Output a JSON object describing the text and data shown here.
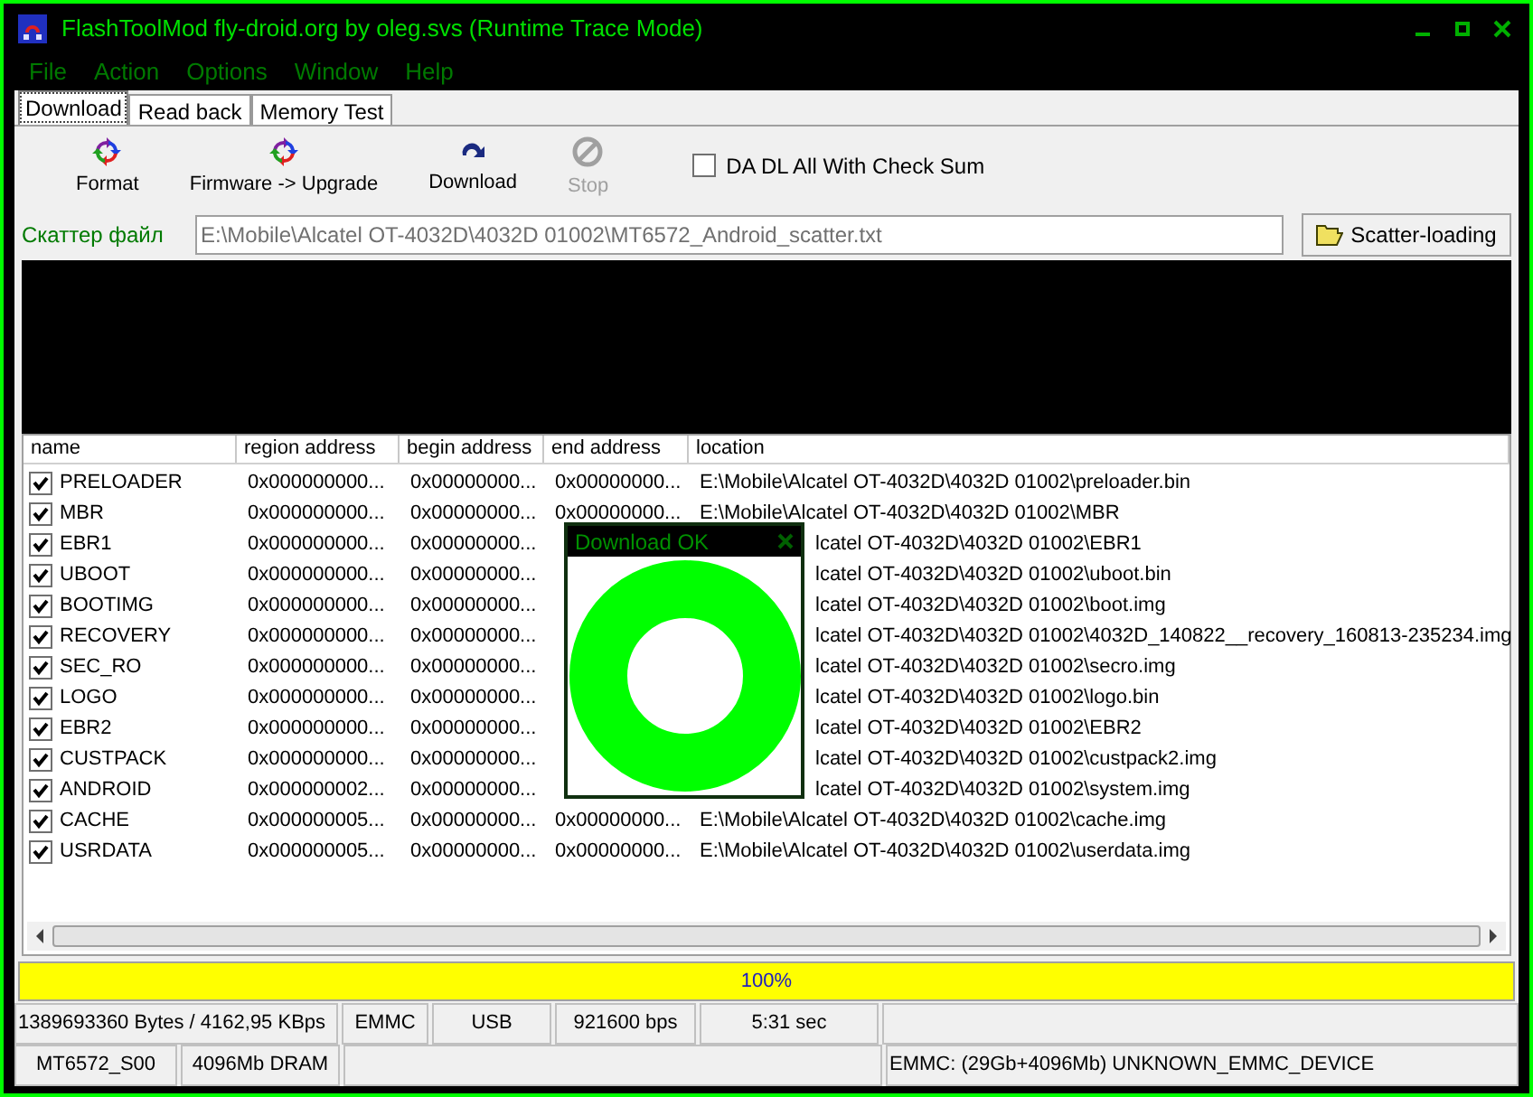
{
  "window": {
    "title": "FlashToolMod fly-droid.org by oleg.svs (Runtime Trace Mode)"
  },
  "menu": [
    "File",
    "Action",
    "Options",
    "Window",
    "Help"
  ],
  "tabs": [
    {
      "label": "Download",
      "selected": true
    },
    {
      "label": "Read back",
      "selected": false
    },
    {
      "label": "Memory Test",
      "selected": false
    }
  ],
  "toolbar": {
    "buttons": [
      {
        "kind": "cycle",
        "label": "Format",
        "disabled": false
      },
      {
        "kind": "cycle",
        "label": "Firmware -> Upgrade",
        "disabled": false
      },
      {
        "kind": "download",
        "label": "Download",
        "disabled": false
      },
      {
        "kind": "stop",
        "label": "Stop",
        "disabled": true
      }
    ],
    "checkbox": {
      "label": "DA DL All With Check Sum",
      "checked": false
    }
  },
  "scatter": {
    "label": "Скаттер файл",
    "value": "E:\\Mobile\\Alcatel OT-4032D\\4032D 01002\\MT6572_Android_scatter.txt",
    "button": "Scatter-loading"
  },
  "table": {
    "columns": [
      "name",
      "region address",
      "begin address",
      "end address",
      "location"
    ],
    "rows": [
      {
        "name": "PRELOADER",
        "checked": true,
        "region": "0x000000000...",
        "begin": "0x00000000...",
        "end": "0x00000000...",
        "location": "E:\\Mobile\\Alcatel OT-4032D\\4032D 01002\\preloader.bin",
        "covered": false
      },
      {
        "name": "MBR",
        "checked": true,
        "region": "0x000000000...",
        "begin": "0x00000000...",
        "end": "0x00000000...",
        "location": "E:\\Mobile\\Alcatel OT-4032D\\4032D 01002\\MBR",
        "covered": false
      },
      {
        "name": "EBR1",
        "checked": true,
        "region": "0x000000000...",
        "begin": "0x00000000...",
        "location": "lcatel OT-4032D\\4032D 01002\\EBR1",
        "covered": true
      },
      {
        "name": "UBOOT",
        "checked": true,
        "region": "0x000000000...",
        "begin": "0x00000000...",
        "location": "lcatel OT-4032D\\4032D 01002\\uboot.bin",
        "covered": true
      },
      {
        "name": "BOOTIMG",
        "checked": true,
        "region": "0x000000000...",
        "begin": "0x00000000...",
        "location": "lcatel OT-4032D\\4032D 01002\\boot.img",
        "covered": true
      },
      {
        "name": "RECOVERY",
        "checked": true,
        "region": "0x000000000...",
        "begin": "0x00000000...",
        "location": "lcatel OT-4032D\\4032D 01002\\4032D_140822__recovery_160813-235234.img",
        "covered": true
      },
      {
        "name": "SEC_RO",
        "checked": true,
        "region": "0x000000000...",
        "begin": "0x00000000...",
        "location": "lcatel OT-4032D\\4032D 01002\\secro.img",
        "covered": true
      },
      {
        "name": "LOGO",
        "checked": true,
        "region": "0x000000000...",
        "begin": "0x00000000...",
        "location": "lcatel OT-4032D\\4032D 01002\\logo.bin",
        "covered": true
      },
      {
        "name": "EBR2",
        "checked": true,
        "region": "0x000000000...",
        "begin": "0x00000000...",
        "location": "lcatel OT-4032D\\4032D 01002\\EBR2",
        "covered": true
      },
      {
        "name": "CUSTPACK",
        "checked": true,
        "region": "0x000000000...",
        "begin": "0x00000000...",
        "location": "lcatel OT-4032D\\4032D 01002\\custpack2.img",
        "covered": true
      },
      {
        "name": "ANDROID",
        "checked": true,
        "region": "0x000000002...",
        "begin": "0x00000000...",
        "location": "lcatel OT-4032D\\4032D 01002\\system.img",
        "covered": true
      },
      {
        "name": "CACHE",
        "checked": true,
        "region": "0x000000005...",
        "begin": "0x00000000...",
        "end": "0x00000000...",
        "location": "E:\\Mobile\\Alcatel OT-4032D\\4032D 01002\\cache.img",
        "covered": false
      },
      {
        "name": "USRDATA",
        "checked": true,
        "region": "0x000000005...",
        "begin": "0x00000000...",
        "end": "0x00000000...",
        "location": "E:\\Mobile\\Alcatel OT-4032D\\4032D 01002\\userdata.img",
        "covered": false
      }
    ]
  },
  "popup": {
    "title": "Download OK"
  },
  "progress": {
    "level": 1,
    "label": "100%"
  },
  "status_bar": {
    "row_1": [
      "1389693360 Bytes / 4162,95 KBps",
      "EMMC",
      "USB",
      "921600 bps",
      "5:31 sec"
    ],
    "row_2": [
      "MT6572_S00",
      "4096Mb DRAM",
      "EMMC: (29Gb+4096Mb) UNKNOWN_EMMC_DEVICE"
    ]
  }
}
